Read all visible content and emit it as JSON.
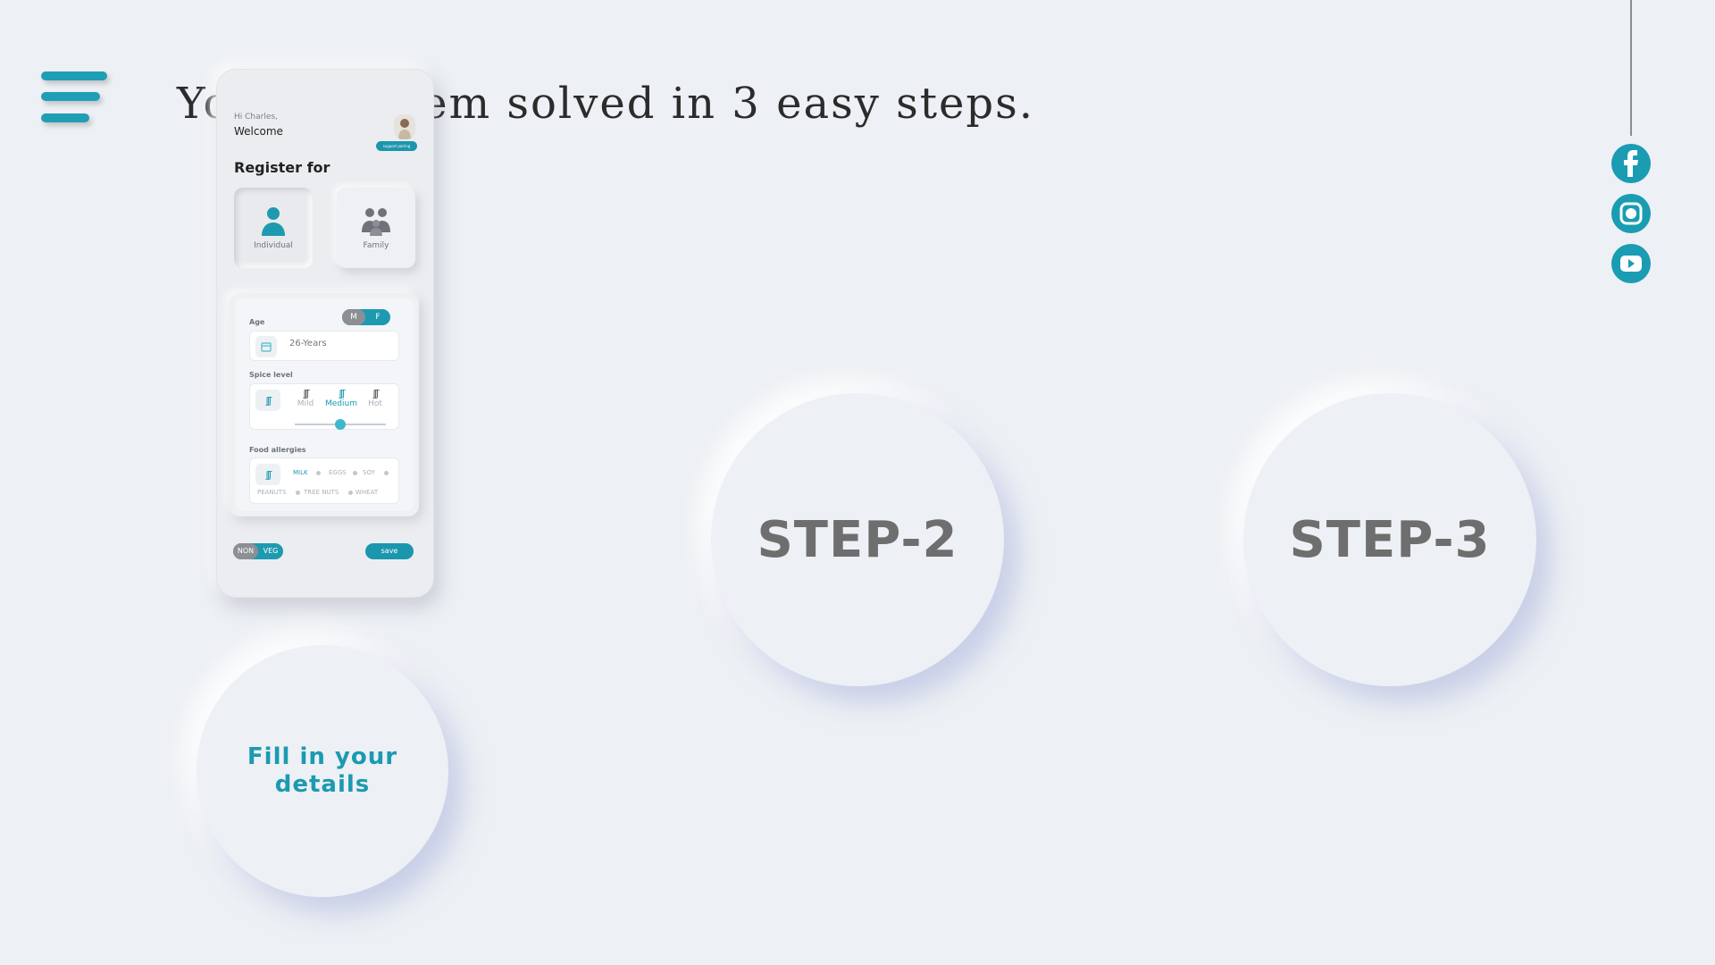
{
  "headline": "Your problem solved in 3 easy steps.",
  "brand_color": "#1f9fb5",
  "menu": {
    "icon": "hamburger-menu-icon"
  },
  "social": [
    {
      "name": "facebook",
      "icon": "facebook-icon"
    },
    {
      "name": "instagram",
      "icon": "instagram-icon"
    },
    {
      "name": "youtube",
      "icon": "youtube-icon"
    }
  ],
  "phone": {
    "greeting_small": "Hi Charles,",
    "greeting": "Welcome",
    "support_label": "support pairing",
    "register_title": "Register for",
    "register_options": [
      {
        "label": "Individual",
        "icon": "person-icon",
        "selected": true
      },
      {
        "label": "Family",
        "icon": "family-icon",
        "selected": false
      }
    ],
    "gender": {
      "m": "M",
      "f": "F",
      "selected": "F"
    },
    "age_label": "Age",
    "age_placeholder": "26-Years",
    "spice_label": "Spice level",
    "spice_options": [
      "Mild",
      "Medium",
      "Hot"
    ],
    "spice_selected": "Medium",
    "spice_level": 0.5,
    "allergy_label": "Food allergies",
    "allergies": [
      "MILK",
      "EGGS",
      "SOY",
      "PEANUTS",
      "TREE NUTS",
      "WHEAT"
    ],
    "allergy_selected": "MILK",
    "diet_toggle": {
      "non": "NON",
      "veg": "VEG",
      "selected": "NON"
    },
    "save_label": "save"
  },
  "steps": [
    {
      "label": "Fill in your details"
    },
    {
      "label": "STEP-2"
    },
    {
      "label": "STEP-3"
    }
  ]
}
